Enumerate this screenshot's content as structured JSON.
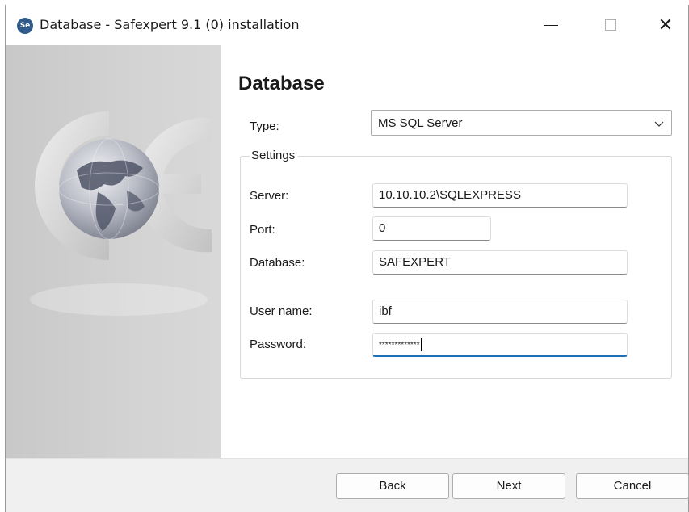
{
  "window": {
    "title": "Database - Safexpert 9.1 (0) installation",
    "app_icon_text": "Se",
    "controls": {
      "minimize": "minimize-icon",
      "maximize": "maximize-icon",
      "close": "close-icon"
    },
    "close_glyph": "✕"
  },
  "page": {
    "title": "Database"
  },
  "type": {
    "label": "Type:",
    "value": "MS SQL Server",
    "icon": "chevron-down-icon"
  },
  "settings": {
    "legend": "Settings",
    "server": {
      "label": "Server:",
      "value": "10.10.10.2\\SQLEXPRESS"
    },
    "port": {
      "label": "Port:",
      "value": "0"
    },
    "database": {
      "label": "Database:",
      "value": "SAFEXPERT"
    },
    "username": {
      "label": "User name:",
      "value": "ibf"
    },
    "password": {
      "label": "Password:",
      "value": "*************"
    }
  },
  "buttons": {
    "back": "Back",
    "next": "Next",
    "cancel": "Cancel"
  },
  "colors": {
    "accent": "#1f6fb7",
    "app_icon": "#2f5a8a",
    "side_panel": "#d3d3d3",
    "footer": "#f0f0f0"
  }
}
